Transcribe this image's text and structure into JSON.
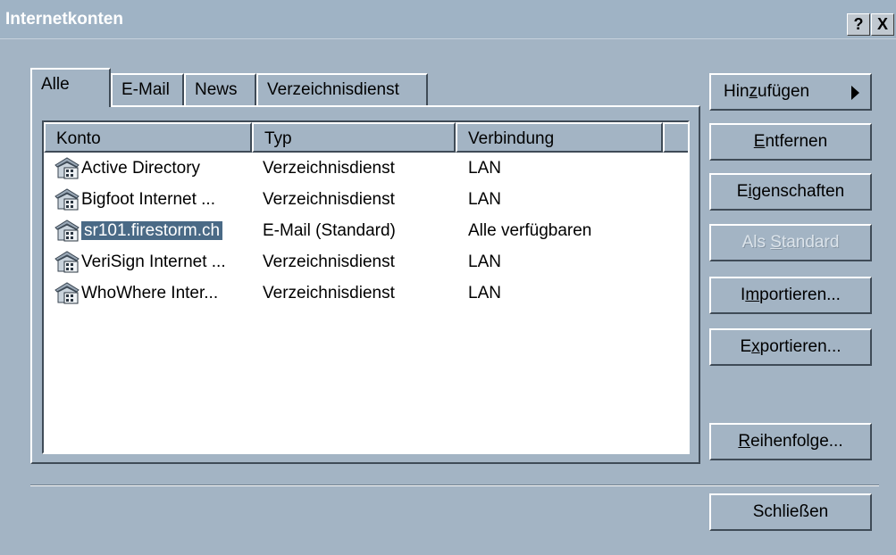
{
  "window": {
    "title": "Internetkonten",
    "help_label": "?",
    "close_label": "X"
  },
  "tabs": [
    {
      "label": "Alle",
      "active": true
    },
    {
      "label": "E-Mail",
      "active": false
    },
    {
      "label": "News",
      "active": false
    },
    {
      "label": "Verzeichnisdienst",
      "active": false
    }
  ],
  "list": {
    "columns": [
      "Konto",
      "Typ",
      "Verbindung"
    ],
    "rows": [
      {
        "konto": "Active Directory",
        "typ": "Verzeichnisdienst",
        "verbindung": "LAN",
        "selected": false
      },
      {
        "konto": "Bigfoot Internet ...",
        "typ": "Verzeichnisdienst",
        "verbindung": "LAN",
        "selected": false
      },
      {
        "konto": "sr101.firestorm.ch",
        "typ": "E-Mail (Standard)",
        "verbindung": "Alle verfügbaren",
        "selected": true
      },
      {
        "konto": "VeriSign Internet ...",
        "typ": "Verzeichnisdienst",
        "verbindung": "LAN",
        "selected": false
      },
      {
        "konto": "WhoWhere Inter...",
        "typ": "Verzeichnisdienst",
        "verbindung": "LAN",
        "selected": false
      }
    ]
  },
  "buttons": {
    "add": {
      "pre": "Hin",
      "key": "z",
      "post": "ufügen"
    },
    "remove": {
      "pre": "",
      "key": "E",
      "post": "ntfernen"
    },
    "properties": {
      "pre": "E",
      "key": "i",
      "post": "genschaften"
    },
    "default": {
      "pre": "Als ",
      "key": "S",
      "post": "tandard",
      "disabled": true
    },
    "import": {
      "pre": "I",
      "key": "m",
      "post": "portieren..."
    },
    "export": {
      "pre": "E",
      "key": "x",
      "post": "portieren..."
    },
    "order": {
      "pre": "",
      "key": "R",
      "post": "eihenfolge..."
    },
    "close": {
      "label": "Schließen"
    }
  },
  "colors": {
    "face": "#a3b4c4",
    "selection": "#4a6a86",
    "title_text": "#ffffff"
  }
}
